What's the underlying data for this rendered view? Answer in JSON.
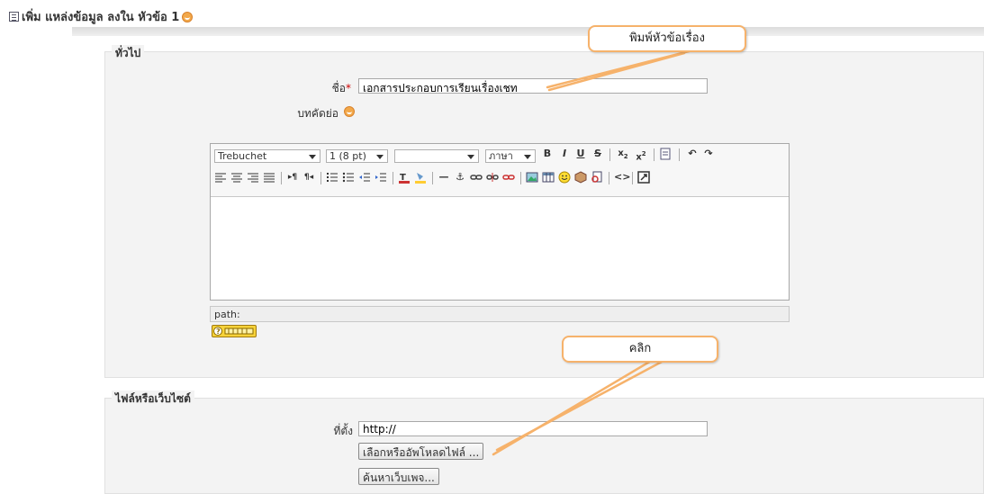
{
  "page": {
    "heading": "เพิ่ม แหล่งข้อมูล ลงใน หัวข้อ 1"
  },
  "sections": {
    "general": {
      "legend": "ทั่วไป",
      "name_label": "ชื่อ",
      "required_mark": "*",
      "name_value": "เอกสารประกอบการเรียนเรื่องเชท",
      "summary_label": "บทคัดย่อ"
    },
    "file": {
      "legend": "ไฟล์หรือเว็บไซต์",
      "location_label": "ที่ตั้ง",
      "location_value": "http://",
      "upload_button": "เลือกหรืออัพโหลดไฟล์ ...",
      "search_button": "ค้นหาเว็บเพจ..."
    }
  },
  "editor": {
    "font_family": "Trebuchet",
    "font_size": "1 (8 pt)",
    "heading_select": "",
    "language_select": "ภาษา",
    "path_label": "path:"
  },
  "callouts": {
    "title_hint": "พิมพ์หัวข้อเรื่อง",
    "click_hint": "คลิก"
  },
  "colors": {
    "callout_border": "#f6b26b",
    "section_bg": "#f3f3f3",
    "required": "#cc0000"
  }
}
